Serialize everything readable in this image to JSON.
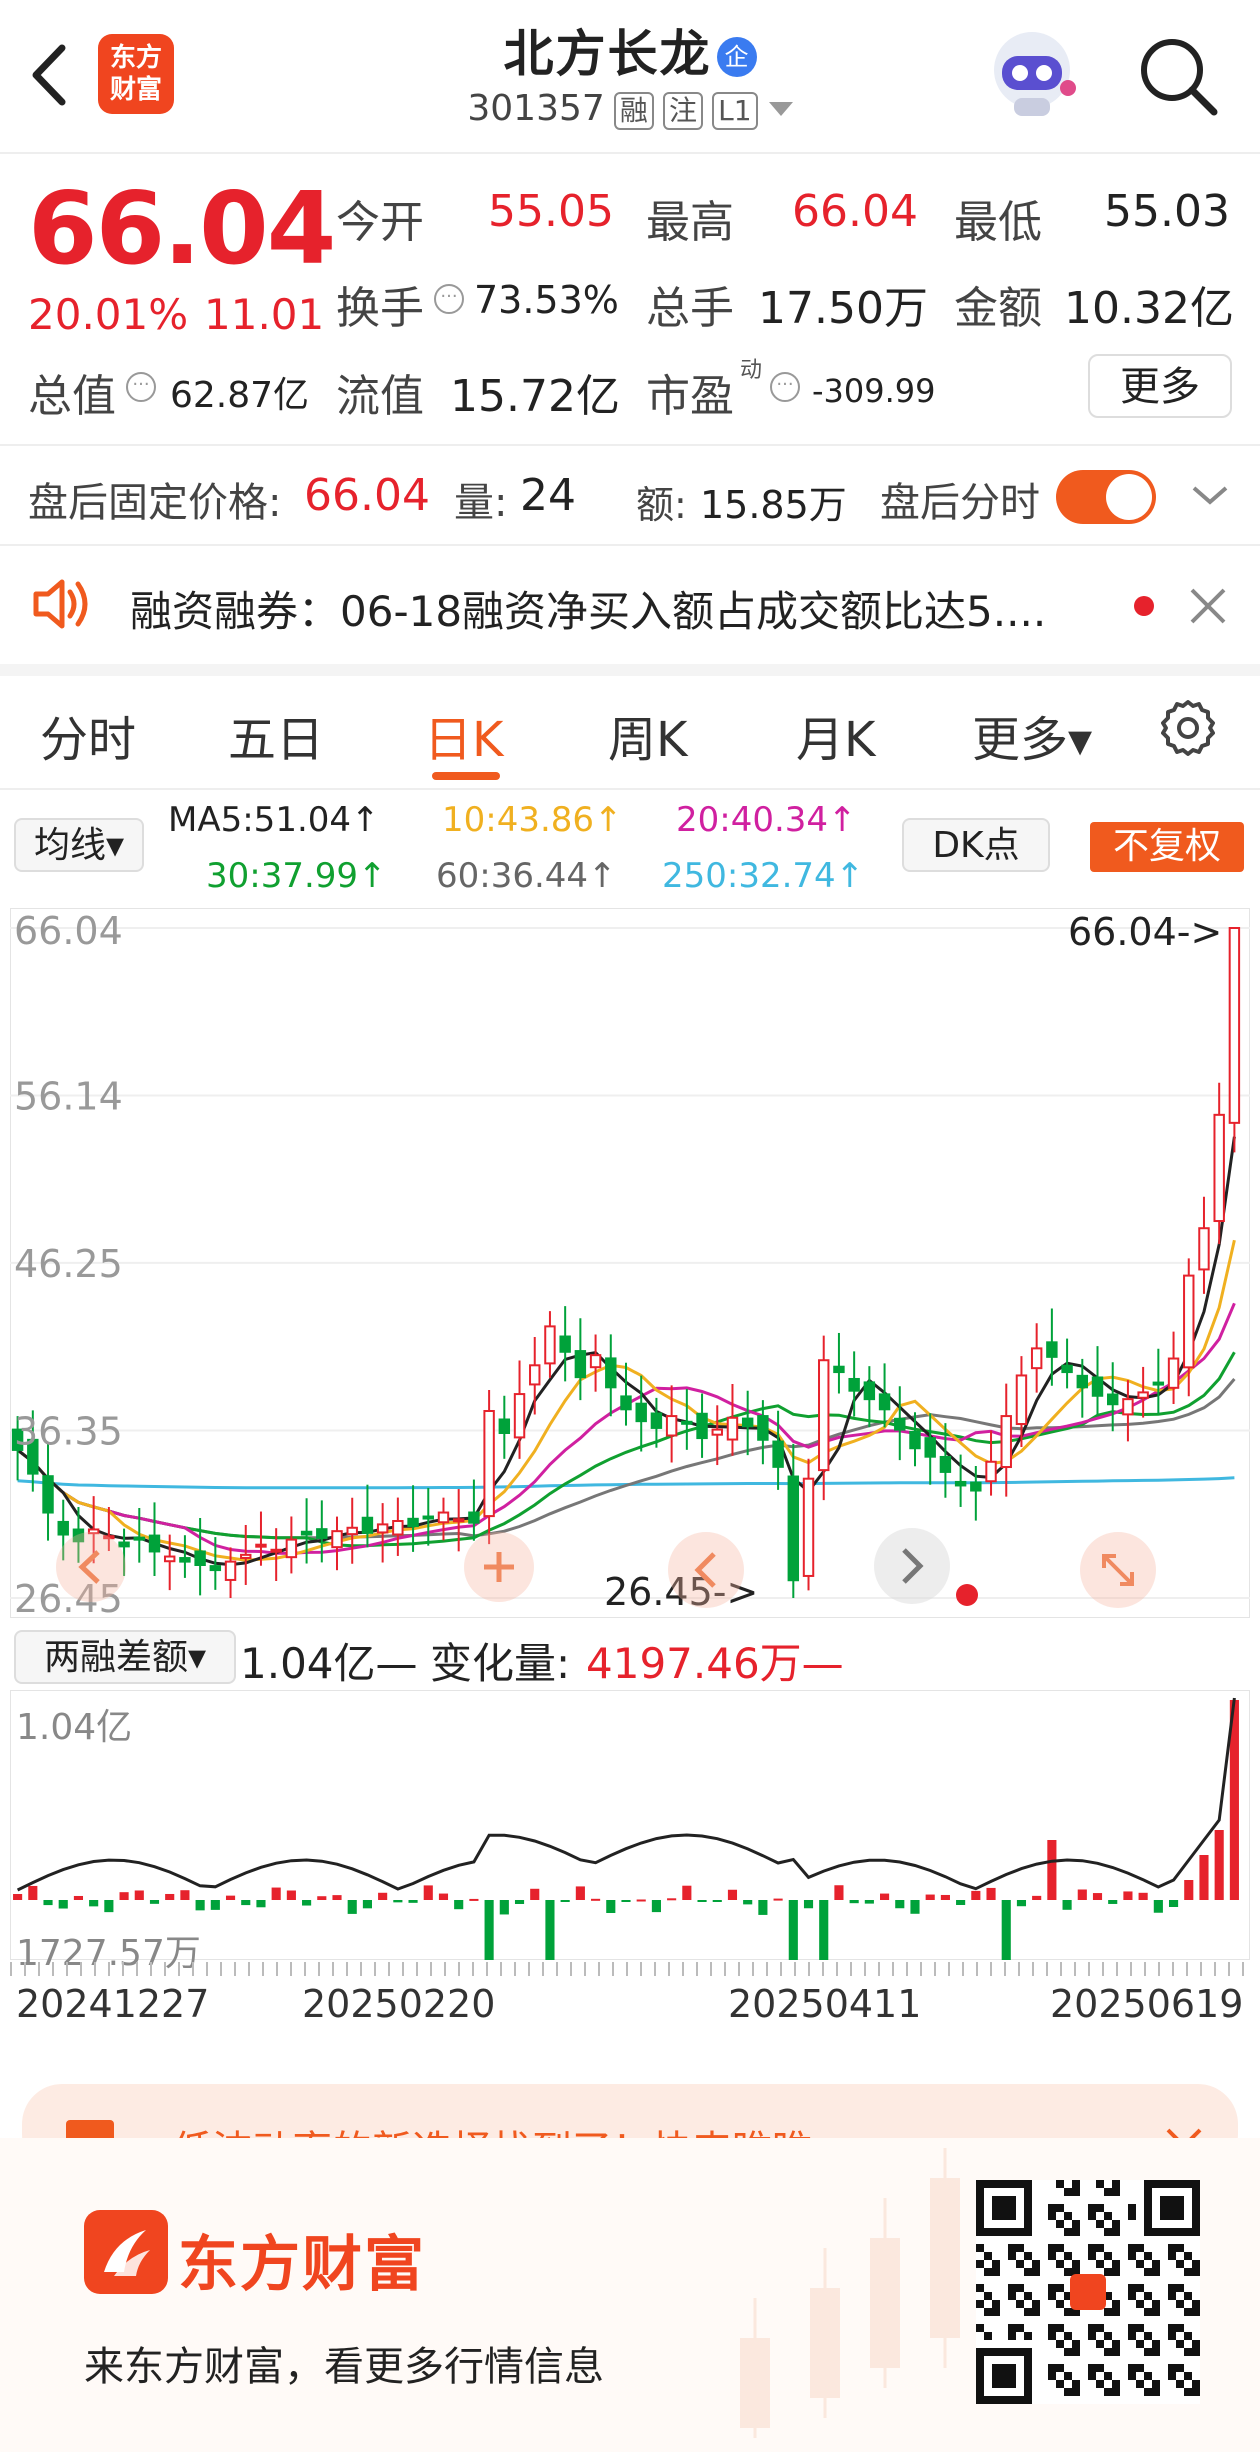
{
  "header": {
    "stock_name": "北方长龙",
    "enterprise_badge": "企",
    "stock_code": "301357",
    "badges": [
      "融",
      "注",
      "L1"
    ],
    "logo_text": "东方\n财富",
    "icons": [
      "back-arrow-icon",
      "robot-avatar-icon",
      "search-icon"
    ]
  },
  "quote": {
    "price": "66.04",
    "change_pct": "20.01%",
    "change_amt": "11.01",
    "fields": [
      {
        "label": "今开",
        "value": "55.05"
      },
      {
        "label": "最高",
        "value": "66.04"
      },
      {
        "label": "最低",
        "value": "55.03"
      },
      {
        "label": "换手",
        "value": "73.53%"
      },
      {
        "label": "总手",
        "value": "17.50万"
      },
      {
        "label": "金额",
        "value": "10.32亿"
      },
      {
        "label": "总值",
        "value": "62.87亿"
      },
      {
        "label": "流值",
        "value": "15.72亿"
      },
      {
        "label": "市盈",
        "value": "-309.99",
        "superscript": "动"
      }
    ],
    "more_button": "更多"
  },
  "after_hours": {
    "label": "盘后固定价格:",
    "price": "66.04",
    "vol_label": "量:",
    "vol": "24",
    "amt_label": "额:",
    "amt": "15.85万",
    "toggle_label": "盘后分时",
    "toggle_on": true
  },
  "notice": {
    "text": "融资融券：06-18融资净买入额占成交额比达5...."
  },
  "tabs": [
    "分时",
    "五日",
    "日K",
    "周K",
    "月K",
    "更多▾"
  ],
  "active_tab": "日K",
  "ma_bar": {
    "selector": "均线▾",
    "ma5": "MA5:51.04↑",
    "ma10": "10:43.86↑",
    "ma20": "20:40.34↑",
    "ma30": "30:37.99↑",
    "ma60": "60:36.44↑",
    "ma250": "250:32.74↑",
    "dk_button": "DK点",
    "adjust_button": "不复权"
  },
  "chart_data": {
    "type": "candlestick",
    "y_ticks": [
      "66.04",
      "56.14",
      "46.25",
      "36.35",
      "26.45"
    ],
    "ylim": [
      26.45,
      66.04
    ],
    "max_label": "66.04->",
    "min_label": "26.45->",
    "ma_colors": {
      "ma5": "#222222",
      "ma10": "#f0b020",
      "ma20": "#d020a0",
      "ma30": "#10a030",
      "ma60": "#777777",
      "ma250": "#40b8e0"
    },
    "candles_approx_close": [
      35.2,
      33.8,
      31.5,
      30.2,
      29.8,
      30.5,
      30.1,
      29.5,
      29.9,
      29.2,
      28.9,
      28.6,
      28.4,
      28.1,
      28.6,
      29.0,
      29.6,
      29.3,
      29.9,
      30.2,
      30.0,
      30.4,
      30.6,
      30.3,
      30.8,
      31.0,
      30.7,
      31.2,
      31.5,
      31.1,
      30.9,
      37.5,
      36.2,
      38.5,
      40.2,
      42.5,
      41.0,
      39.5,
      40.8,
      38.9,
      37.6,
      36.9,
      36.5,
      37.2,
      36.8,
      35.9,
      36.4,
      37.1,
      36.6,
      35.8,
      34.2,
      27.5,
      33.5,
      40.5,
      39.8,
      38.7,
      38.2,
      37.6,
      36.4,
      35.3,
      34.8,
      33.9,
      33.1,
      32.8,
      34.5,
      37.2,
      39.6,
      41.2,
      40.7,
      39.8,
      38.9,
      38.4,
      37.9,
      38.2,
      38.6,
      39.1,
      40.6,
      45.5,
      48.3,
      55.0,
      66.04
    ]
  },
  "margin": {
    "selector": "两融差额▾",
    "value": "1.04亿—",
    "change_label": "变化量:",
    "change": "4197.46万—",
    "y_max": "1.04亿",
    "y_min": "1727.57万"
  },
  "x_dates": [
    "20241227",
    "20250220",
    "20250411",
    "20250619"
  ],
  "nav_icons": [
    "left-arrow-icon",
    "zoom-in-icon",
    "prev-icon",
    "next-icon",
    "expand-icon"
  ],
  "promo": {
    "text": "低波动率的新选择找到了！快来瞧瞧>>"
  },
  "footer": {
    "brand": "东方财富",
    "slogan": "来东方财富，看更多行情信息"
  }
}
